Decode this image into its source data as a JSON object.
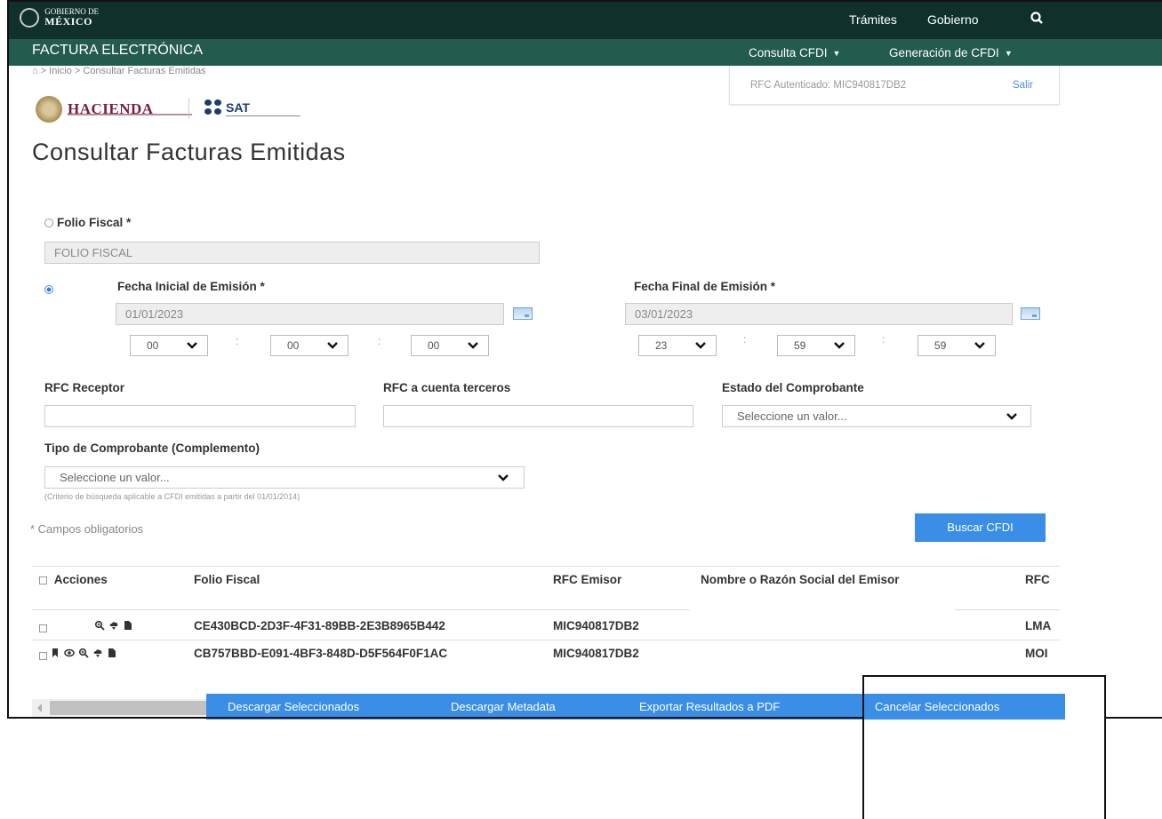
{
  "topbar": {
    "gov_small": "GOBIERNO DE",
    "gov_big": "MÉXICO",
    "links": [
      "Trámites",
      "Gobierno"
    ]
  },
  "navbar": {
    "title": "FACTURA ELECTRÓNICA",
    "menu": [
      "Consulta CFDI",
      "Generación de CFDI"
    ]
  },
  "breadcrumb": "⌂ > Inicio > Consultar Facturas Emitidas",
  "auth": {
    "text": "RFC Autenticado: MIC940817DB2",
    "exit": "Salir"
  },
  "logos": {
    "hacienda": "HACIENDA",
    "sat": "SAT"
  },
  "page_title": "Consultar Facturas Emitidas",
  "form": {
    "folio_label": "Folio Fiscal *",
    "folio_placeholder": "FOLIO FISCAL",
    "fecha_inicial_label": "Fecha Inicial de Emisión *",
    "fecha_inicial_value": "01/01/2023",
    "fecha_final_label": "Fecha Final de Emisión *",
    "fecha_final_value": "03/01/2023",
    "hora_inicial": [
      "00",
      "00",
      "00"
    ],
    "hora_final": [
      "23",
      "59",
      "59"
    ],
    "colon": ":",
    "rfc_receptor_label": "RFC Receptor",
    "rfc_terceros_label": "RFC a cuenta terceros",
    "estado_label": "Estado del Comprobante",
    "estado_value": "Seleccione un valor...",
    "tipo_label": "Tipo de Comprobante (Complemento)",
    "tipo_value": "Seleccione un valor...",
    "hint": "(Criterio de búsqueda aplicable a CFDI emitidas a partir del 01/01/2014)",
    "required_note": "* Campos obligatorios",
    "search_button": "Buscar CFDI"
  },
  "table": {
    "headers": [
      "Acciones",
      "Folio Fiscal",
      "RFC Emisor",
      "Nombre o Razón Social del Emisor",
      "RFC"
    ],
    "rows": [
      {
        "folio": "CE430BCD-2D3F-4F31-89BB-2E3B8965B442",
        "rfc_emisor": "MIC940817DB2",
        "nombre": "",
        "rfc": "LMA"
      },
      {
        "folio": "CB757BBD-E091-4BF3-848D-D5F564F0F1AC",
        "rfc_emisor": "MIC940817DB2",
        "nombre": "",
        "rfc": "MOI"
      }
    ]
  },
  "bottom_buttons": [
    "Descargar Seleccionados",
    "Descargar Metadata",
    "Exportar Resultados a PDF",
    "Cancelar Seleccionados"
  ],
  "colors": {
    "topbar": "#10312b",
    "navbar": "#235b4e",
    "primary_button": "#3a8ee6",
    "hacienda": "#7a1d36",
    "sat": "#1b3d6d"
  }
}
